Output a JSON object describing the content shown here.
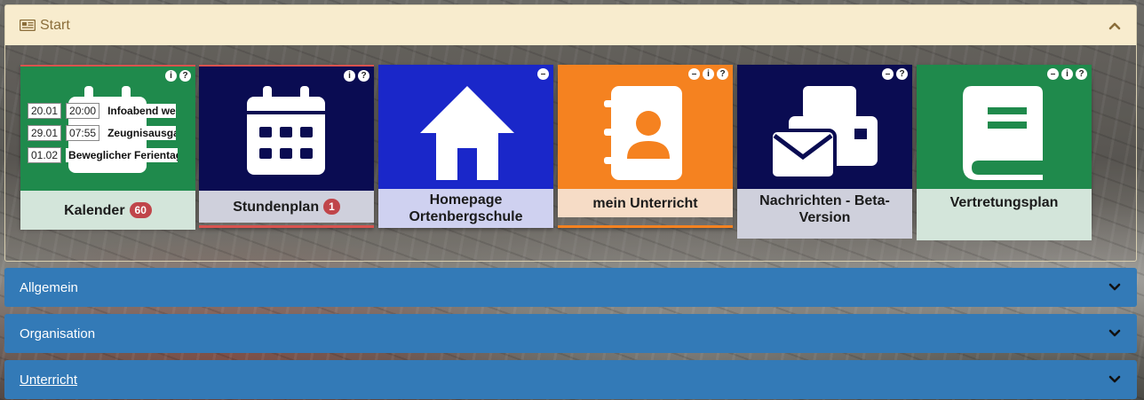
{
  "start": {
    "title": "Start"
  },
  "tiles": [
    {
      "label": "Kalender",
      "count": "60",
      "events": [
        {
          "date": "20.01",
          "time": "20:00",
          "text": "Infoabend weiterführende Schulen"
        },
        {
          "date": "29.01",
          "time": "07:55",
          "text": "Zeugnisausgabe"
        },
        {
          "date": "01.02",
          "time": "",
          "text": "Beweglicher Ferientag"
        }
      ],
      "colors": {
        "top": "#1f8a4c",
        "bottom": "#d3e5da",
        "line": "#d9534f"
      }
    },
    {
      "label": "Stundenplan",
      "count": "1",
      "colors": {
        "top": "#0a0c52",
        "bottom": "#cfd0dc",
        "line": "#d9534f"
      }
    },
    {
      "label": "Homepage Ortenbergschule",
      "colors": {
        "top": "#1a27c9",
        "bottom": "#cfd1f0",
        "line": "#1a27c9"
      }
    },
    {
      "label": "mein Unterricht",
      "colors": {
        "top": "#f58220",
        "bottom": "#f6dcc6",
        "line": "#f58220"
      }
    },
    {
      "label": "Nachrichten - Beta-Version",
      "colors": {
        "top": "#0a0c52",
        "bottom": "#cfd0dc",
        "line": "#0a0c52"
      }
    },
    {
      "label": "Vertretungsplan",
      "colors": {
        "top": "#1f8a4c",
        "bottom": "#d3e5da",
        "line": "#1f8a4c"
      }
    }
  ],
  "sections": [
    {
      "label": "Allgemein"
    },
    {
      "label": "Organisation"
    },
    {
      "label": "Unterricht"
    }
  ],
  "icons": {
    "info": "i",
    "help": "?",
    "minus": "–"
  }
}
